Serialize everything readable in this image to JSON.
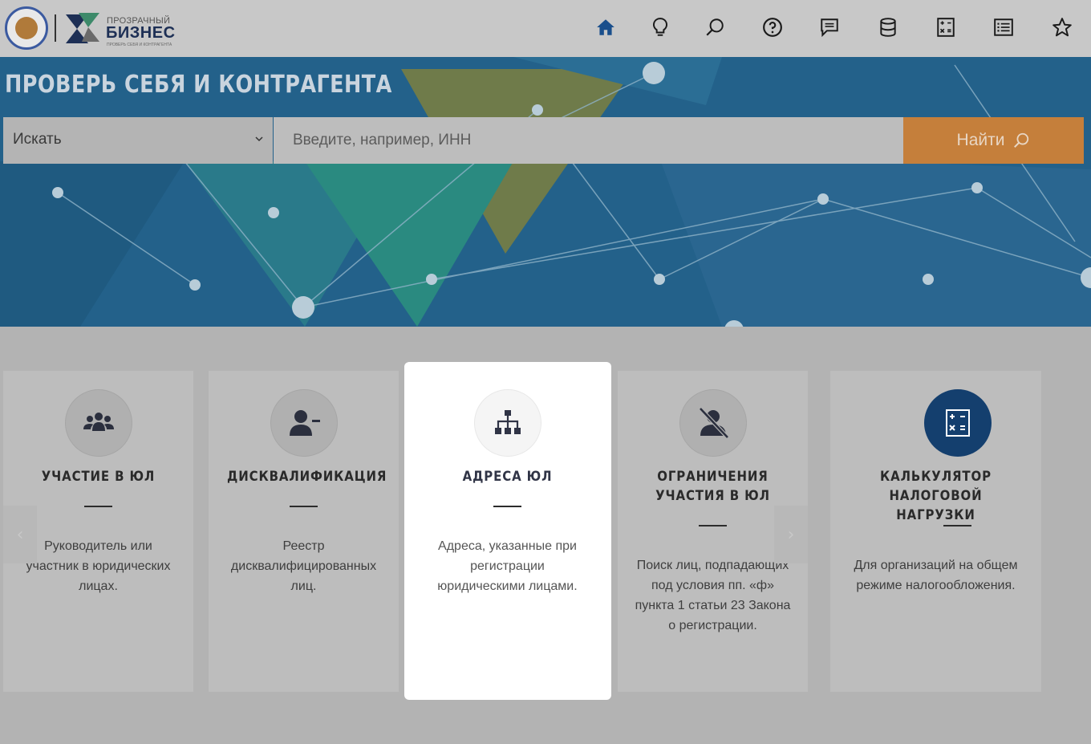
{
  "header": {
    "logo_small": "ПРОЗРАЧНЫЙ",
    "logo_big": "БИЗНЕС",
    "logo_tiny": "ПРОВЕРЬ СЕБЯ И КОНТРАГЕНТА",
    "nav_icons": [
      "home-icon",
      "lightbulb-icon",
      "search-icon",
      "question-icon",
      "comment-icon",
      "database-icon",
      "calculator-icon",
      "list-icon",
      "star-icon"
    ]
  },
  "banner": {
    "title": "ПРОВЕРЬ СЕБЯ И КОНТРАГЕНТА",
    "select_value": "Искать",
    "search_placeholder": "Введите, например, ИНН",
    "search_button": "Найти"
  },
  "cards": [
    {
      "title": "УЧАСТИЕ В ЮЛ",
      "desc": "Руководитель или участник в юридических лицах.",
      "icon": "users-icon"
    },
    {
      "title": "ДИСКВАЛИФИКАЦИЯ",
      "desc": "Реестр дисквалифицированных лиц.",
      "icon": "user-minus-icon"
    },
    {
      "title": "АДРЕСА ЮЛ",
      "desc": "Адреса, указанные при регистрации юридическими лицами.",
      "icon": "sitemap-icon"
    },
    {
      "title": "ОГРАНИЧЕНИЯ УЧАСТИЯ В ЮЛ",
      "desc": "Поиск лиц, подпадающих под условия пп. «ф» пункта 1 статьи 23 Закона о регистрации.",
      "icon": "user-slash-icon"
    },
    {
      "title": "КАЛЬКУЛЯТОР НАЛОГОВОЙ НАГРУЗКИ",
      "desc": "Для организаций на общем режиме налогообложения.",
      "icon": "calculator-icon"
    }
  ],
  "colors": {
    "accent_orange": "#c57f3b",
    "brand_navy": "#143f6e",
    "banner_blue": "#23618a"
  },
  "carousel": {
    "prev": "‹",
    "next": "›"
  }
}
